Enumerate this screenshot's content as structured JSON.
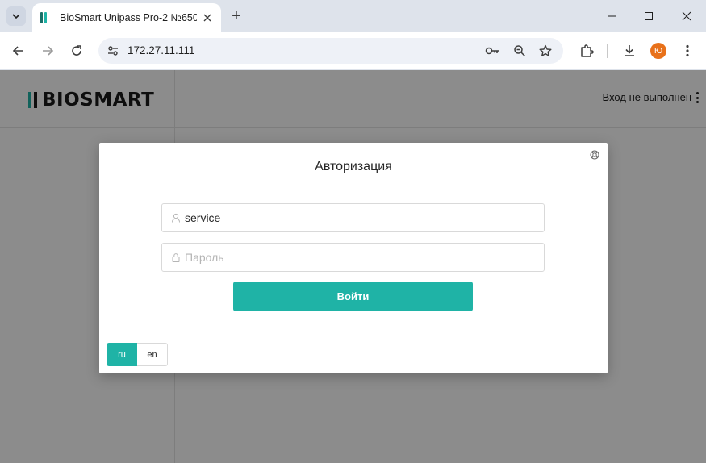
{
  "browser": {
    "tab_title": "BioSmart Unipass Pro-2 №6502",
    "new_tab_label": "+",
    "url": "172.27.11.111",
    "profile_initial": "Ю",
    "icons": {
      "tab_menu": "chevron-down-icon",
      "favicon": "biosmart-favicon",
      "tab_close": "close-icon",
      "minimize": "minimize-icon",
      "maximize": "maximize-icon",
      "window_close": "close-icon",
      "back": "arrow-left-icon",
      "forward": "arrow-right-icon",
      "reload": "reload-icon",
      "site_info": "tune-icon",
      "passwords": "key-icon",
      "zoom": "zoom-icon",
      "bookmark": "star-icon",
      "extensions": "puzzle-icon",
      "downloads": "download-icon",
      "menu": "kebab-icon"
    }
  },
  "page": {
    "logo_text": "BIOSMART",
    "login_status": "Вход не выполнен"
  },
  "modal": {
    "title": "Авторизация",
    "username_value": "service",
    "password_placeholder": "Пароль",
    "login_button": "Войти",
    "languages": [
      {
        "label": "ru",
        "active": true
      },
      {
        "label": "en",
        "active": false
      }
    ],
    "icons": {
      "help": "lifebuoy-icon",
      "user": "user-icon",
      "lock": "lock-icon"
    }
  },
  "colors": {
    "accent": "#1fb3a6",
    "chrome_bg": "#dee3eb",
    "overlay": "rgba(0,0,0,0.45)",
    "avatar": "#e8711a"
  }
}
